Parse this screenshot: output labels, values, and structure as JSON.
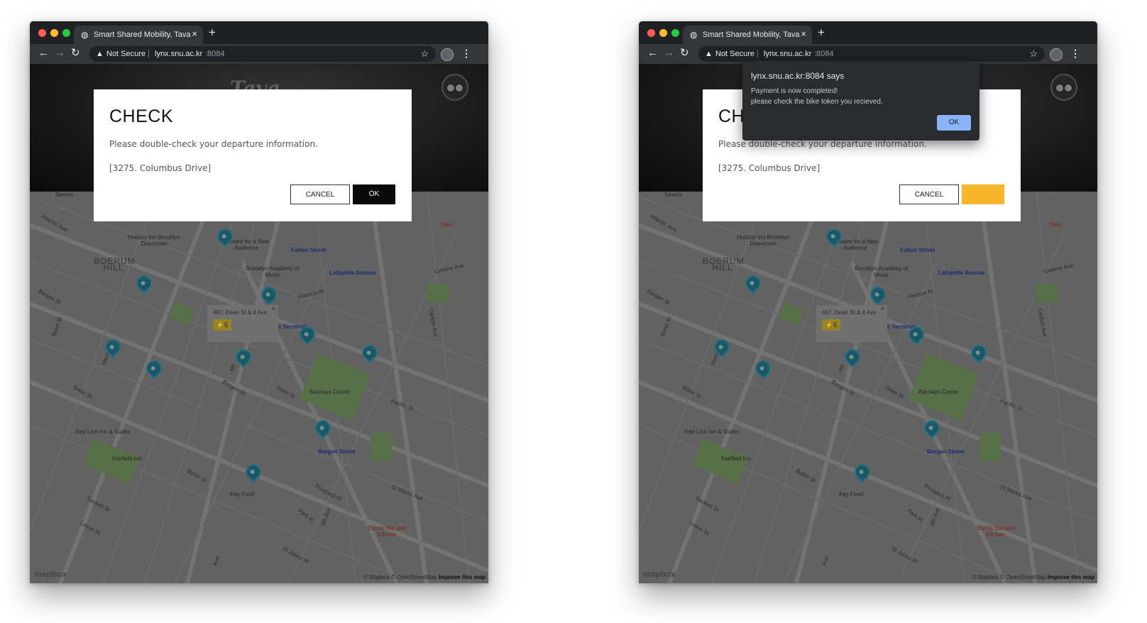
{
  "browser": {
    "tab_title": "Smart Shared Mobility, Tava",
    "tab_close": "×",
    "new_tab": "+",
    "back": "←",
    "forward": "→",
    "reload": "↻",
    "security_label": "Not Secure",
    "url_host": "lynx.snu.ac.kr",
    "url_port": ":8084",
    "star": "☆",
    "menu": "⋮"
  },
  "app": {
    "logo": "Tava"
  },
  "modal": {
    "title": "CHECK",
    "message": "Please double-check your departure information.",
    "location": "[3275. Columbus Drive]",
    "cancel_label": "CANCEL",
    "ok_label": "OK"
  },
  "alert": {
    "title": "lynx.snu.ac.kr:8084 says",
    "line1": "Payment is now completed!",
    "line2": "please check the bike token you recieved.",
    "ok_label": "OK"
  },
  "map": {
    "popup_address": "467. Dean St & 4 Ave",
    "popup_close": "×",
    "popup_battery": "⚡5",
    "attribution": "© Mapbox © OpenStreetMap",
    "improve_link": "Improve this map",
    "mapbox_logo": "mapbox",
    "places": {
      "streets": "Streets",
      "holiday_inn": "Holiday Inn Brooklyn Downtown",
      "theatre": "Theatre for a New Audience",
      "fulton": "Fulton Street",
      "olea": "Olea",
      "boerum": "BOERUM HILL",
      "bam": "Brooklyn Academy of Music",
      "lafayette": "Lafayette Avenue",
      "greene": "Greene Ave",
      "hanson": "Hanson Pl",
      "terminal": "c Terminal",
      "barclays": "Barclays Center",
      "pacific": "Pacific St",
      "red_lion": "Red Lion Inn & Suites",
      "fairfield": "Fairfield Inn",
      "bergen_station": "Bergen Street",
      "key_food": "Key Food",
      "burrito": "Burrito Bar and Kitchen",
      "atlantic": "Atlantic Ave",
      "bergen_st": "Bergen St",
      "baltic": "Baltic St",
      "butler": "Butler St",
      "sackett": "Sackett St",
      "union": "Union St",
      "dean": "Dean St",
      "prospect": "Prospect Pl",
      "st_marks": "St Marks Ave",
      "park_pl": "Park Pl",
      "st_johns": "St Johns Pl",
      "carlton": "Carlton Ave",
      "fourth": "4th",
      "sixth": "6th Ave",
      "bond": "Bond St",
      "nevins": "Nevins",
      "ave": "Ave"
    }
  }
}
